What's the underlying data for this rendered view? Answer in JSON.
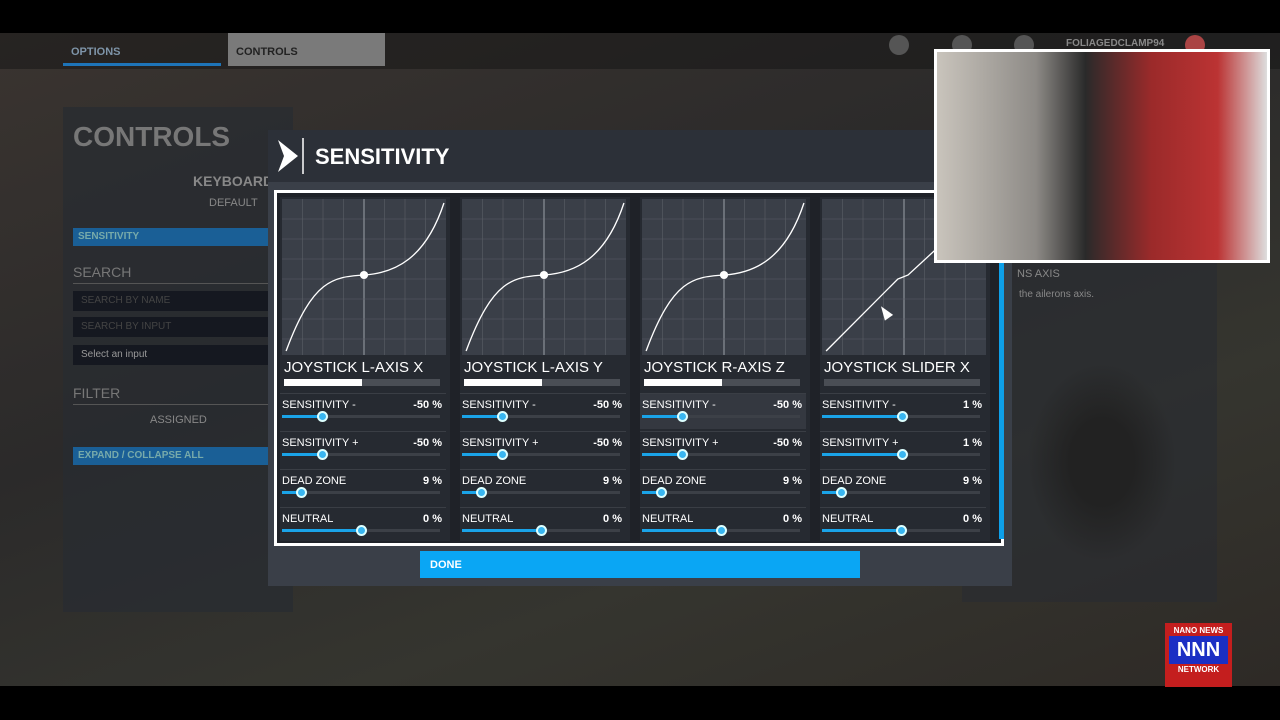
{
  "topnav": {
    "tabs": [
      {
        "label": "OPTIONS"
      },
      {
        "label": "CONTROLS"
      }
    ],
    "username": "FOLIAGEDCLAMP94"
  },
  "left": {
    "title": "CONTROLS",
    "device": "KEYBOARD",
    "profile": "DEFAULT",
    "sensitivity": "SENSITIVITY",
    "search": "SEARCH",
    "search_name_placeholder": "SEARCH BY NAME",
    "search_input_placeholder": "SEARCH BY INPUT",
    "select_input": "Select an input",
    "filter": "FILTER",
    "filter_value": "ASSIGNED",
    "expand": "EXPAND / COLLAPSE ALL"
  },
  "right": {
    "axis_title": "NS AXIS",
    "description": "the ailerons axis."
  },
  "modal": {
    "title": "SENSITIVITY",
    "done": "DONE",
    "axes": [
      {
        "name": "JOYSTICK L-AXIS X",
        "input_level": 0.5,
        "curve": "s",
        "rows": [
          {
            "label": "SENSITIVITY -",
            "value": "-50 %",
            "v": -50
          },
          {
            "label": "SENSITIVITY +",
            "value": "-50 %",
            "v": -50
          },
          {
            "label": "DEAD ZONE",
            "value": "9 %",
            "v": 9
          },
          {
            "label": "NEUTRAL",
            "value": "0 %",
            "v": 0
          }
        ]
      },
      {
        "name": "JOYSTICK L-AXIS Y",
        "input_level": 0.5,
        "curve": "s",
        "rows": [
          {
            "label": "SENSITIVITY -",
            "value": "-50 %",
            "v": -50
          },
          {
            "label": "SENSITIVITY +",
            "value": "-50 %",
            "v": -50
          },
          {
            "label": "DEAD ZONE",
            "value": "9 %",
            "v": 9
          },
          {
            "label": "NEUTRAL",
            "value": "0 %",
            "v": 0
          }
        ]
      },
      {
        "name": "JOYSTICK R-AXIS Z",
        "input_level": 0.5,
        "curve": "s",
        "rows": [
          {
            "label": "SENSITIVITY -",
            "value": "-50 %",
            "v": -50
          },
          {
            "label": "SENSITIVITY +",
            "value": "-50 %",
            "v": -50
          },
          {
            "label": "DEAD ZONE",
            "value": "9 %",
            "v": 9
          },
          {
            "label": "NEUTRAL",
            "value": "0 %",
            "v": 0
          }
        ]
      },
      {
        "name": "JOYSTICK SLIDER X",
        "input_level": 0,
        "curve": "linear",
        "rows": [
          {
            "label": "SENSITIVITY -",
            "value": "1 %",
            "v": 1
          },
          {
            "label": "SENSITIVITY +",
            "value": "1 %",
            "v": 1
          },
          {
            "label": "DEAD ZONE",
            "value": "9 %",
            "v": 9
          },
          {
            "label": "NEUTRAL",
            "value": "0 %",
            "v": 0
          }
        ]
      }
    ]
  },
  "logo": {
    "top": "NANO NEWS",
    "mid": "NNN",
    "bottom": "NETWORK"
  },
  "colors": {
    "accent": "#0aa6f4",
    "panel": "#3a3f48"
  }
}
